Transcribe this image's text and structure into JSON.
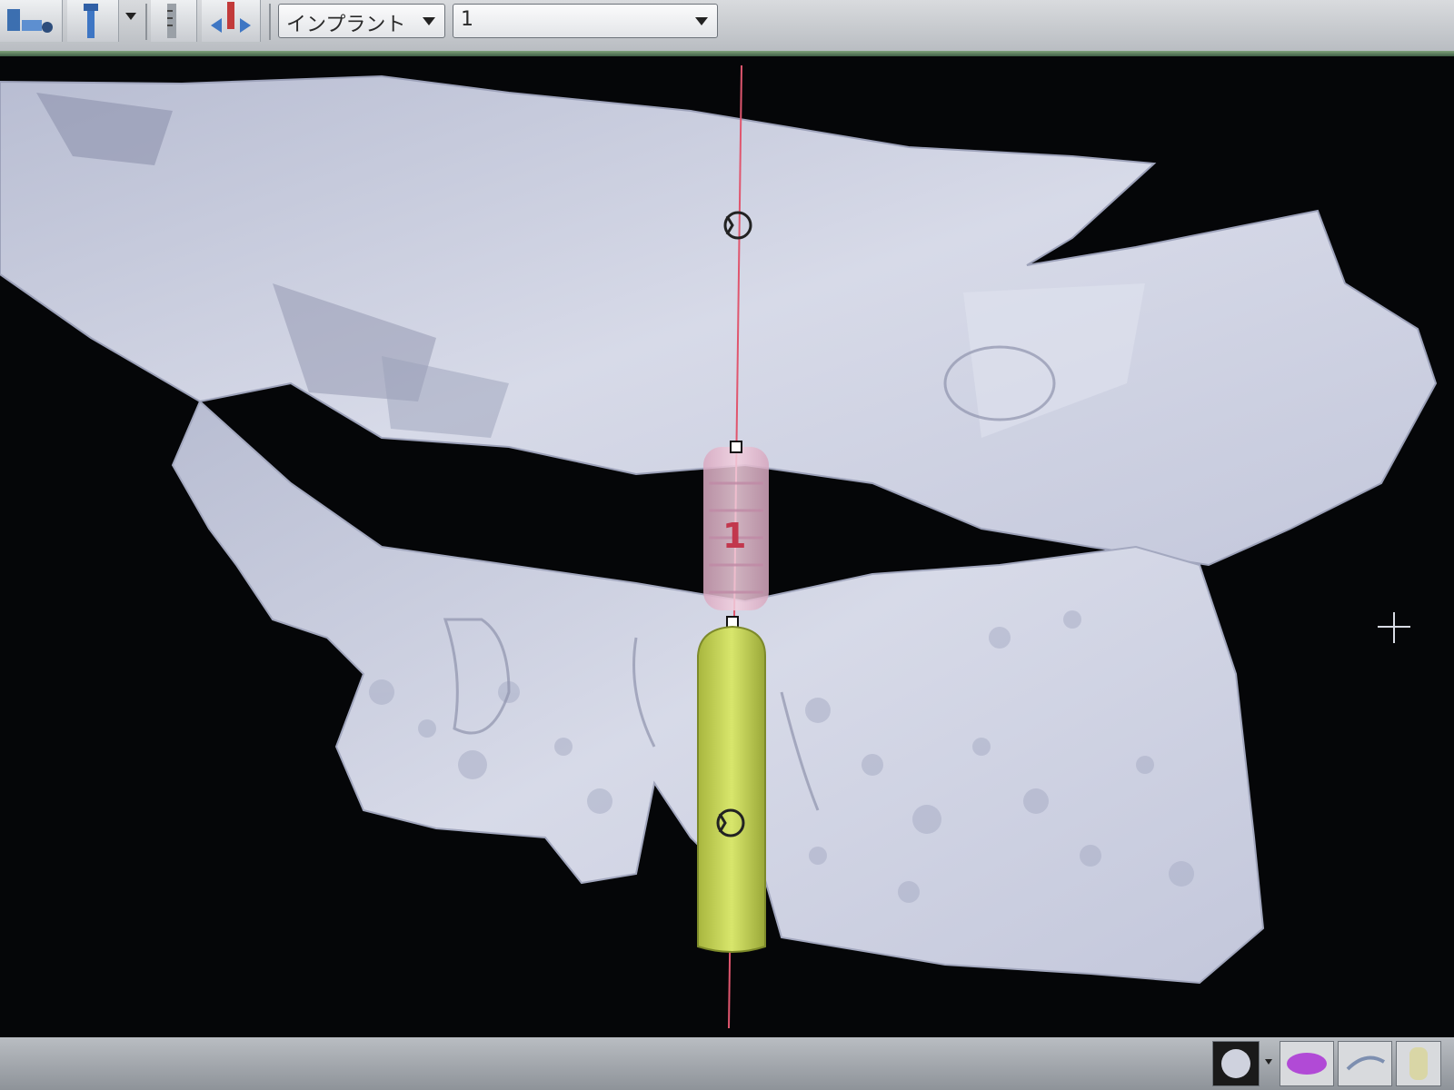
{
  "toolbar": {
    "buttons": [
      {
        "name": "jaw-view-icon"
      },
      {
        "name": "implant-tool-icon"
      },
      {
        "name": "ruler-icon"
      },
      {
        "name": "implant-rotate-icon"
      }
    ],
    "object_type_select": {
      "value": "インプラント"
    },
    "implant_number_select": {
      "value": "1"
    }
  },
  "viewport": {
    "implant_label": "1",
    "axis_color": "#e0566e",
    "implant_color": "#c8d85a",
    "bone_color": "#c9cde0"
  },
  "bottombar": {
    "thumbnails": [
      {
        "name": "bone-render-thumbnail-icon"
      },
      {
        "name": "soft-tissue-thumbnail-icon"
      },
      {
        "name": "nerve-thumbnail-icon"
      },
      {
        "name": "tooth-thumbnail-icon"
      }
    ]
  }
}
